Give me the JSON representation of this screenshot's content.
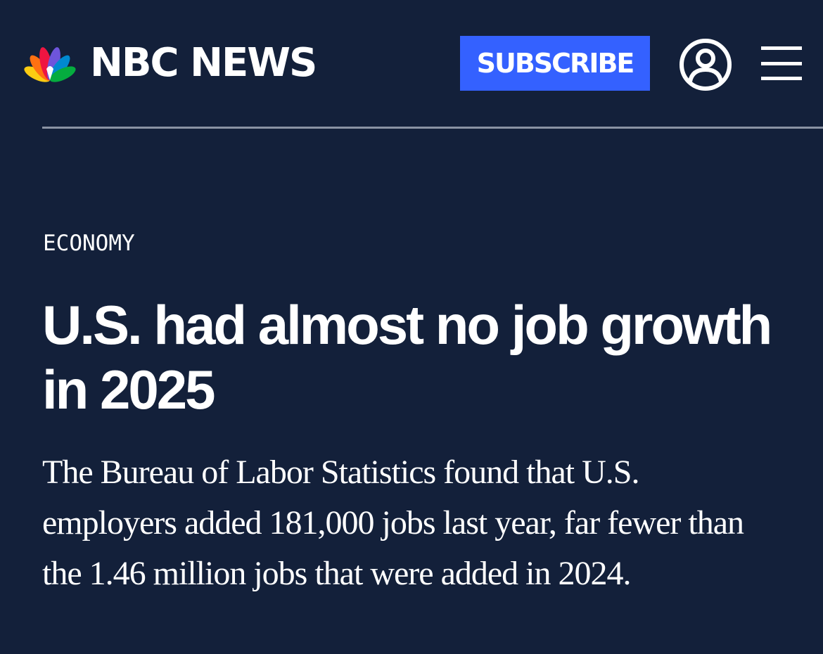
{
  "header": {
    "logo_text": "NBC NEWS",
    "subscribe_label": "SUBSCRIBE",
    "account_icon": "user-circle-icon",
    "menu_icon": "hamburger-menu-icon"
  },
  "colors": {
    "background": "#13203a",
    "subscribe_button": "#3461ff",
    "divider": "#8a93a3",
    "peacock": [
      "#fccc12",
      "#ef1541",
      "#6e55dc",
      "#0089d0",
      "#05ac3f",
      "#ff7112"
    ]
  },
  "article": {
    "category": "ECONOMY",
    "headline": "U.S. had almost no job growth in 2025",
    "dek": "The Bureau of Labor Statistics found that U.S. employers added 181,000 jobs last year, far fewer than the 1.46 million jobs that were added in 2024."
  }
}
